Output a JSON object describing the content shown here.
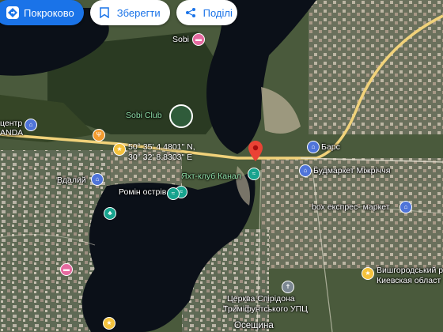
{
  "toolbar": {
    "directions_label": "Покроково",
    "save_label": "Зберегти",
    "share_label": "Поділі"
  },
  "places": {
    "sobi": "Sobi",
    "sobi_club": "Sobi Club",
    "center_line1": "центр",
    "center_line2": "ANDA",
    "vdaliy": "Вдалий",
    "romin": "Ромін острів",
    "yacht": "Яхт-клуб Канал",
    "bars": "Барс",
    "budmarket": "Будмаркет Міжріччя",
    "box": "box експрес- маркет",
    "church_line1": "Церква Спірідона",
    "church_line2": "Триміфунтського УПЦ",
    "vyshgorod_line1": "Вишгородський р",
    "vyshgorod_line2": "Киевская област",
    "osesch": "Осещина"
  },
  "coordinates": {
    "lat": "50° 35' 4.4801\" N,",
    "lon": "30° 32' 8.8303\" E"
  },
  "colors": {
    "water": "#0b1018",
    "road": "#f1d27a",
    "marker": "#ea4335",
    "accent": "#1a73e8"
  }
}
